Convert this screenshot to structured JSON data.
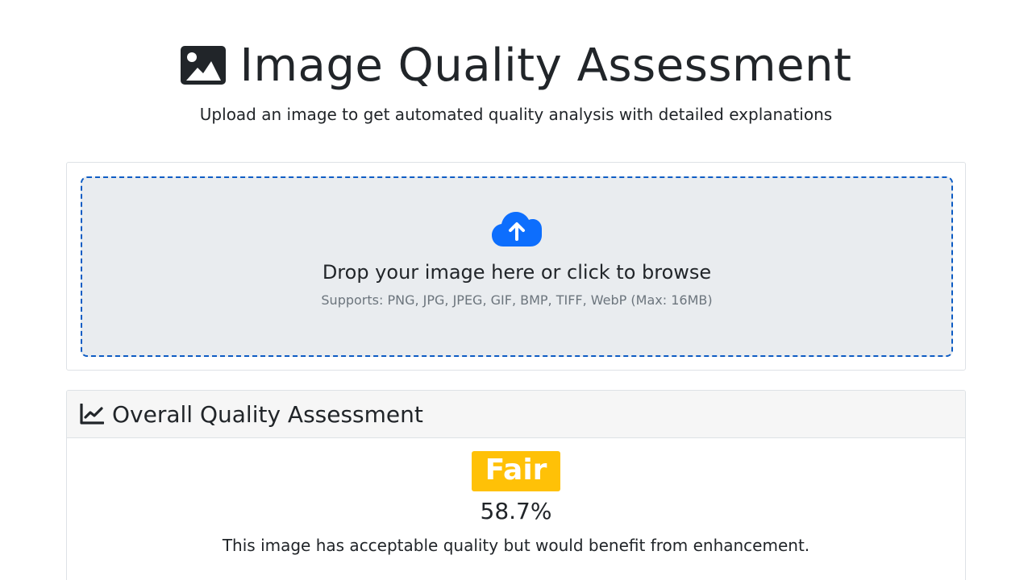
{
  "header": {
    "title": "Image Quality Assessment",
    "subtitle": "Upload an image to get automated quality analysis with detailed explanations",
    "icon": "image-icon"
  },
  "upload": {
    "icon": "cloud-upload-icon",
    "prompt": "Drop your image here or click to browse",
    "supports": "Supports: PNG, JPG, JPEG, GIF, BMP, TIFF, WebP (Max: 16MB)",
    "accent_color": "#0d6efd"
  },
  "result": {
    "icon": "line-chart-icon",
    "title": "Overall Quality Assessment",
    "grade": "Fair",
    "grade_color": "#ffc107",
    "score": "58.7%",
    "description": "This image has acceptable quality but would benefit from enhancement."
  }
}
